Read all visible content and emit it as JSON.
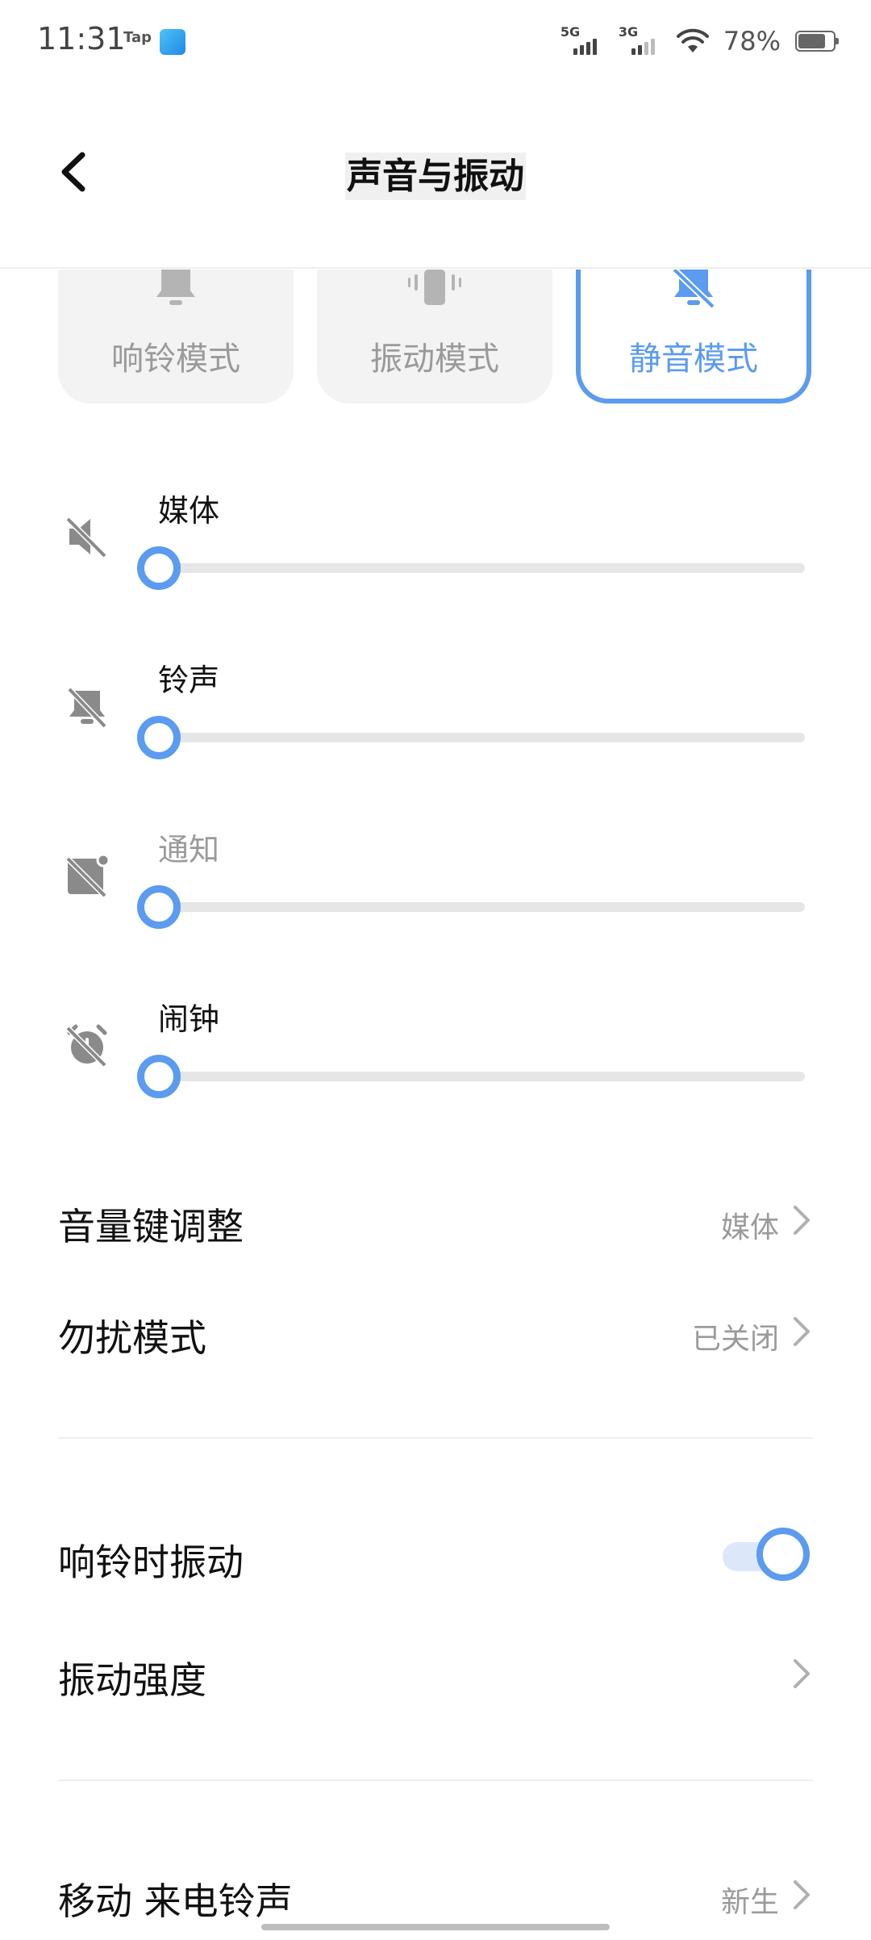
{
  "status_bar": {
    "time": "11:31",
    "tap_label": "Tap",
    "sim1_type": "5G",
    "sim2_type": "3G",
    "battery_percent": "78%"
  },
  "header": {
    "title": "声音与振动",
    "back_icon": "chevron-left-icon"
  },
  "modes": [
    {
      "label": "响铃模式",
      "icon": "bell-icon",
      "active": false
    },
    {
      "label": "振动模式",
      "icon": "vibrate-icon",
      "active": false
    },
    {
      "label": "静音模式",
      "icon": "bell-muted-icon",
      "active": true
    }
  ],
  "volumes": [
    {
      "label": "媒体",
      "icon": "speaker-muted-icon",
      "level": 0,
      "enabled": true
    },
    {
      "label": "铃声",
      "icon": "bell-muted-icon",
      "level": 0,
      "enabled": true
    },
    {
      "label": "通知",
      "icon": "notification-muted-icon",
      "level": 0,
      "enabled": false
    },
    {
      "label": "闹钟",
      "icon": "alarm-muted-icon",
      "level": 0,
      "enabled": true
    }
  ],
  "settings": {
    "volume_key": {
      "label": "音量键调整",
      "value": "媒体"
    },
    "dnd": {
      "label": "勿扰模式",
      "value": "已关闭"
    },
    "vibrate_on_ring": {
      "label": "响铃时振动",
      "on": true
    },
    "vibration_strength": {
      "label": "振动强度"
    },
    "ringtone": {
      "label": "移动 来电铃声",
      "value": "新生"
    }
  },
  "colors": {
    "accent": "#5b9bf0",
    "muted_text": "#9a9a9a",
    "card_bg": "#f3f3f3",
    "track": "#e6e6e6"
  }
}
